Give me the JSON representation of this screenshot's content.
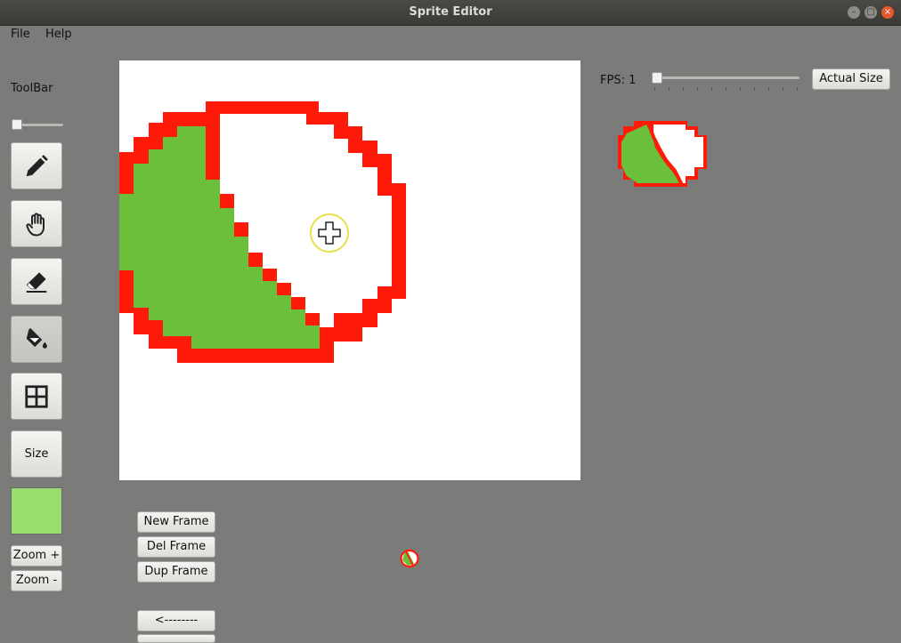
{
  "window": {
    "title": "Sprite Editor"
  },
  "menu": {
    "file": "File",
    "help": "Help"
  },
  "toolbar": {
    "label": "ToolBar",
    "tools": [
      "pencil",
      "hand",
      "eraser",
      "paint-bucket",
      "grid"
    ],
    "size_label": "Size",
    "current_color": "#98dd6e",
    "zoom_in": "Zoom +",
    "zoom_out": "Zoom -"
  },
  "frames": {
    "new_frame": "New Frame",
    "del_frame": "Del Frame",
    "dup_frame": "Dup Frame",
    "prev": "<--------"
  },
  "preview": {
    "fps_label": "FPS: 1",
    "fps_value": 1,
    "actual_size": "Actual Size"
  },
  "colors": {
    "sprite_outline": "#ff1a0a",
    "sprite_fill": "#6bbf3a",
    "background": "#7b7b79"
  }
}
